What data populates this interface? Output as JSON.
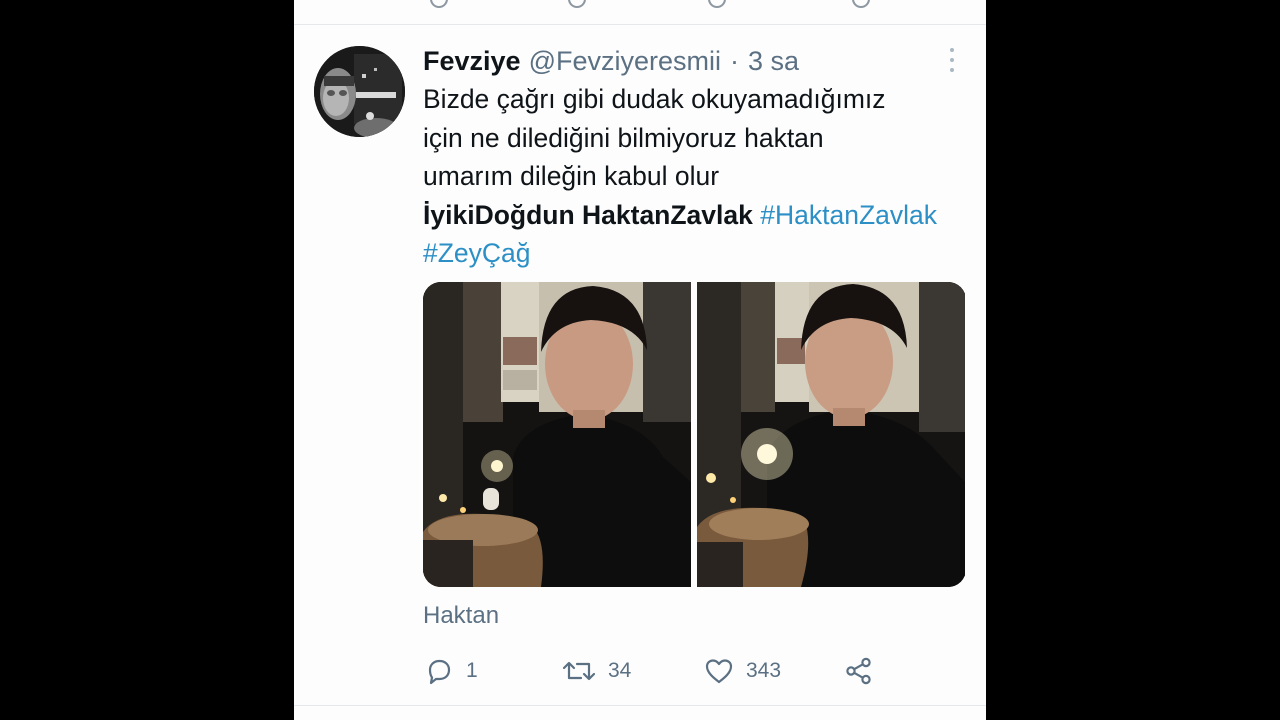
{
  "tweet": {
    "display_name": "Fevziye",
    "handle": "@Fevziyeresmii",
    "separator": "·",
    "time": "3 sa",
    "text_lines": [
      "Bizde çağrı gibi dudak okuyamadığımız",
      "için ne dilediğini bilmiyoruz haktan",
      "umarım dileğin kabul olur"
    ],
    "bold_text": "İyikiDoğdun HaktanZavlak",
    "hashtag_1": "#HaktanZavlak",
    "hashtag_2": "#ZeyÇağ",
    "caption": "Haktan"
  },
  "actions": {
    "reply": {
      "icon": "reply-icon",
      "count": "1"
    },
    "retweet": {
      "icon": "retweet-icon",
      "count": "34"
    },
    "like": {
      "icon": "heart-icon",
      "count": "343"
    },
    "share": {
      "icon": "share-icon"
    }
  },
  "colors": {
    "background": "#000000",
    "card": "#fdfdfd",
    "text": "#0f1419",
    "secondary": "#5b7083",
    "hashtag": "#2c8fc5",
    "divider": "#e6e9ec"
  }
}
